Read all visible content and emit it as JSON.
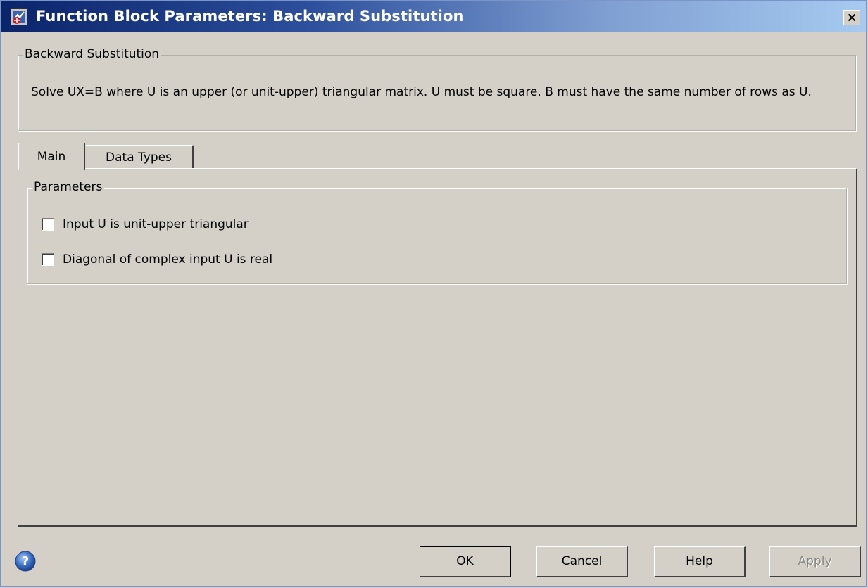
{
  "window": {
    "title": "Function Block Parameters: Backward Substitution",
    "close_label": "×"
  },
  "block": {
    "group_label": "Backward Substitution",
    "description": "Solve UX=B where U is an upper (or unit-upper) triangular matrix.  U must be square.  B must have the same number of rows as U."
  },
  "tabs": [
    {
      "label": "Main",
      "active": true
    },
    {
      "label": "Data Types",
      "active": false
    }
  ],
  "parameters": {
    "group_label": "Parameters",
    "checkboxes": [
      {
        "label": "Input U is unit-upper triangular",
        "checked": false
      },
      {
        "label": "Diagonal of complex input U is real",
        "checked": false
      }
    ]
  },
  "buttons": {
    "ok": "OK",
    "cancel": "Cancel",
    "help": "Help",
    "apply": "Apply"
  },
  "colors": {
    "title_gradient_start": "#0a246a",
    "title_gradient_end": "#a6caf0",
    "dialog_background": "#d4d0c8",
    "help_icon": "#3a6fc4"
  },
  "icons": {
    "title": "simulink-block-icon",
    "close": "close-icon",
    "help": "help-question-icon"
  }
}
